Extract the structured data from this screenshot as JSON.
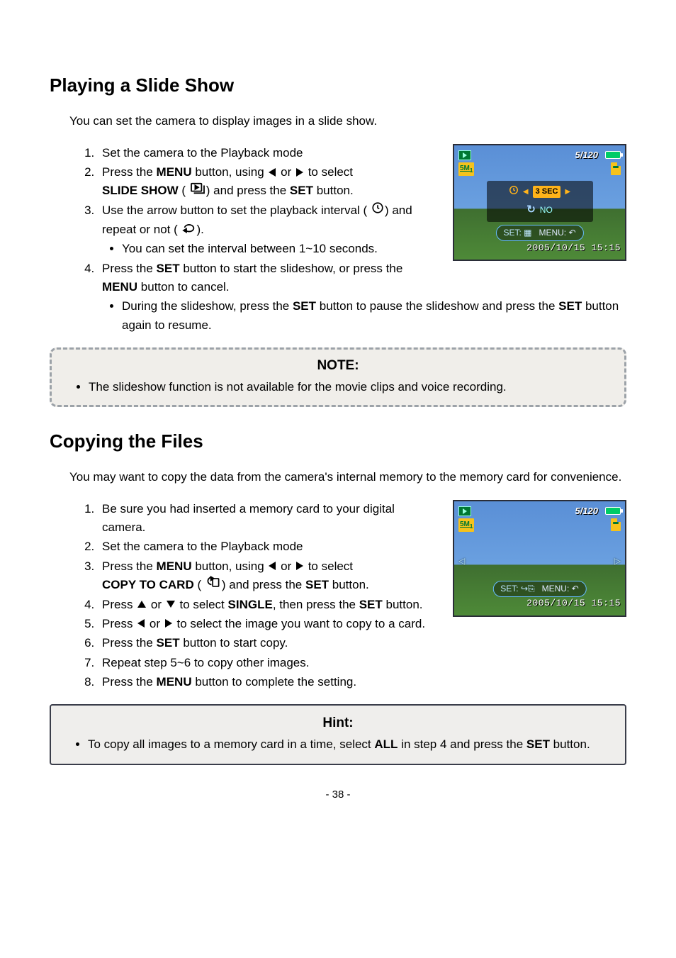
{
  "page": {
    "number": "- 38 -"
  },
  "section1": {
    "heading": "Playing a Slide Show",
    "intro": "You can set the camera to display images in a slide show.",
    "steps": {
      "s1": "Set the camera to the Playback mode",
      "s2a": "Press the ",
      "s2_menu": "MENU",
      "s2b": " button, using ",
      "s2c": " or ",
      "s2d": " to select ",
      "s2_slide": "SLIDE SHOW",
      "s2e": " (",
      "s2f": ") and press the ",
      "s2_set": "SET",
      "s2g": " button.",
      "s3a": "Use the arrow button to set the playback interval (",
      "s3b": ") and repeat or not (",
      "s3c": ").",
      "s3_sub": "You can set the interval between 1~10 seconds.",
      "s4a": "Press the ",
      "s4_set": "SET",
      "s4b": " button to start the slideshow, or press the ",
      "s4_menu": "MENU",
      "s4c": " button to cancel.",
      "s4_sub_a": "During the slideshow, press the ",
      "s4_sub_set1": "SET",
      "s4_sub_b": " button to pause the slideshow and press the ",
      "s4_sub_set2": "SET",
      "s4_sub_c": " button again to resume."
    },
    "note": {
      "title": "NOTE:",
      "text": "The slideshow function is not available for the movie clips and voice recording."
    }
  },
  "section2": {
    "heading": "Copying the Files",
    "intro": "You may want to copy the data from the camera's internal memory to the memory card for convenience.",
    "steps": {
      "s1": "Be sure you had inserted a memory card to your digital camera.",
      "s2": "Set the camera to the Playback mode",
      "s3a": "Press the ",
      "s3_menu": "MENU",
      "s3b": " button, using ",
      "s3c": " or ",
      "s3d": " to select ",
      "s3_copy": "COPY TO CARD",
      "s3e": " (",
      "s3f": ") and press the ",
      "s3_set": "SET",
      "s3g": " button.",
      "s4a": "Press ",
      "s4b": " or ",
      "s4c": " to select ",
      "s4_single": "SINGLE",
      "s4d": ", then press the ",
      "s4_set": "SET",
      "s4e": " button.",
      "s5a": "Press ",
      "s5b": " or ",
      "s5c": " to select the image you want to copy to a card.",
      "s6a": "Press the ",
      "s6_set": "SET",
      "s6b": " button to start copy.",
      "s7": "Repeat step 5~6 to copy other images.",
      "s8a": "Press the ",
      "s8_menu": "MENU",
      "s8b": " button to complete the setting."
    },
    "hint": {
      "title": "Hint:",
      "a": "To copy all images to a memory card in a time, select ",
      "all": "ALL",
      "b": " in step 4 and press the ",
      "set": "SET",
      "c": " button."
    }
  },
  "shot1": {
    "counter": "5/120",
    "res": "5M",
    "interval": "3 SEC",
    "repeat": "NO",
    "set_label": "SET:",
    "menu_label": "MENU:",
    "timestamp": "2005/10/15 15:15"
  },
  "shot2": {
    "counter": "5/120",
    "res": "5M",
    "set_label": "SET:",
    "menu_label": "MENU:",
    "timestamp": "2005/10/15 15:15"
  }
}
